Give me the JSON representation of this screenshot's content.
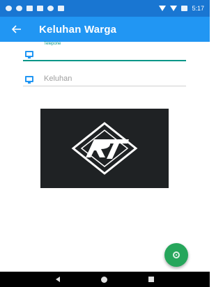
{
  "status_bar": {
    "time": "5:17",
    "icons": [
      "settings-icon",
      "location-icon",
      "image-icon",
      "cast-icon",
      "circle-icon",
      "sd-card-icon",
      "wifi-icon",
      "signal-icon",
      "battery-icon"
    ]
  },
  "app_bar": {
    "title": "Keluhan Warga",
    "back_icon": "arrow-left-icon"
  },
  "form": {
    "phone_label": "Telepone",
    "phone_value": "",
    "phone_icon": "monitor-icon",
    "complaint_placeholder": "Keluhan",
    "complaint_icon": "monitor-icon"
  },
  "logo": {
    "icon": "rt-logo"
  },
  "fab": {
    "icon": "target-icon"
  },
  "nav_bar": {
    "icons": [
      "back-triangle-icon",
      "home-circle-icon",
      "recents-square-icon"
    ]
  },
  "colors": {
    "status_bar": "#1976d2",
    "app_bar": "#2196f3",
    "accent": "#009688",
    "fab": "#26a65b",
    "logo_bg": "#1f2224"
  }
}
